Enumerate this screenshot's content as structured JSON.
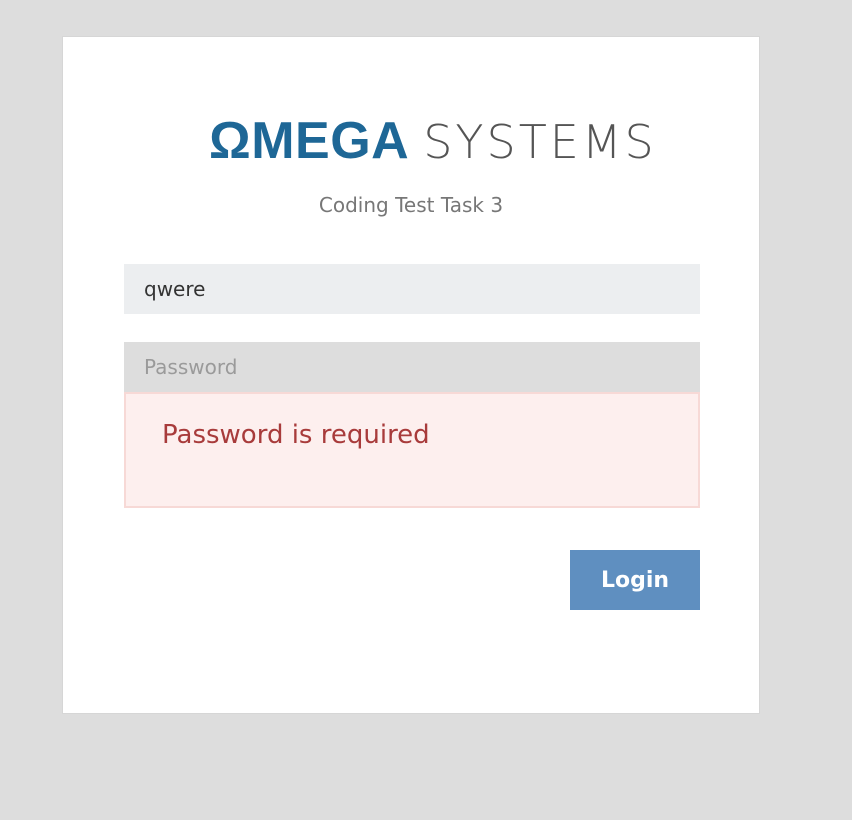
{
  "logo": {
    "brand": "ΩMEGA",
    "suffix": "SYSTEMS"
  },
  "subtitle": "Coding Test Task 3",
  "form": {
    "username_value": "qwere",
    "password_placeholder": "Password",
    "password_error": "Password is required",
    "login_label": "Login"
  },
  "colors": {
    "brand": "#1e6796",
    "error_text": "#a83b3b",
    "error_bg": "#fdefee",
    "button": "#5f8fc0"
  }
}
